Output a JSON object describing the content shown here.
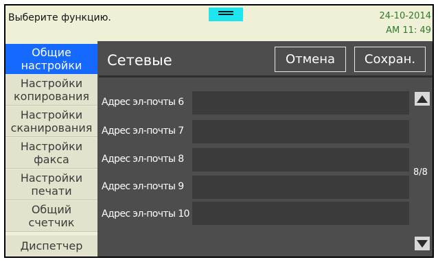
{
  "header": {
    "prompt": "Выберите функцию.",
    "date": "24-10-2014",
    "time": "AM 11: 49",
    "status_icon": "menu-lines-icon"
  },
  "sidebar": {
    "items": [
      {
        "label": "Общие\nнастройки",
        "active": true
      },
      {
        "label": "Настройки\nкопирования",
        "active": false
      },
      {
        "label": "Настройки\nсканирования",
        "active": false
      },
      {
        "label": "Настройки\nфакса",
        "active": false
      },
      {
        "label": "Настройки\nпечати",
        "active": false
      },
      {
        "label": "Общий\nсчетчик",
        "active": false
      },
      {
        "label": "Диспетчер",
        "active": false
      }
    ]
  },
  "main": {
    "title": "Сетевые",
    "cancel_label": "Отмена",
    "save_label": "Сохран.",
    "rows": [
      {
        "label": "Адрес эл-почты 6",
        "value": ""
      },
      {
        "label": "Адрес эл-почты 7",
        "value": ""
      },
      {
        "label": "Адрес эл-почты 8",
        "value": ""
      },
      {
        "label": "Адрес эл-почты 9",
        "value": ""
      },
      {
        "label": "Адрес эл-почты 10",
        "value": ""
      }
    ],
    "page_indicator": "8/8",
    "scroll_up_icon": "triangle-up-icon",
    "scroll_down_icon": "triangle-down-icon"
  },
  "colors": {
    "active_tab": "#1569ff",
    "header_bg": "#f0f0d6",
    "clock_text": "#2b7b2b",
    "panel_bg": "#4d4d4d",
    "indicator": "#1ee6f0"
  }
}
